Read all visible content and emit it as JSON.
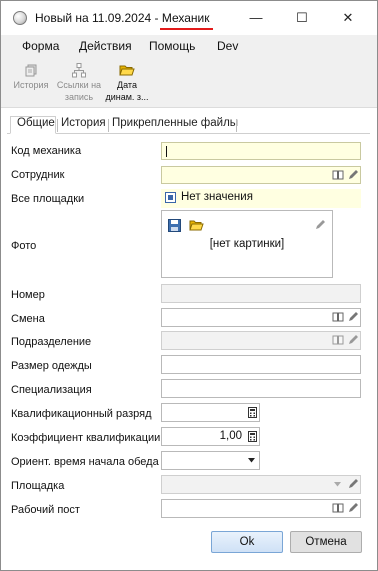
{
  "window": {
    "title_prefix": "Новый на 11.09.2024 - ",
    "title_entity": "Механик",
    "controls": {
      "minimize": "—",
      "maximize": "☐",
      "close": "✕"
    }
  },
  "menu": [
    "Форма",
    "Действия",
    "Помощь",
    "Dev"
  ],
  "toolbar": {
    "history_label": "История",
    "links_label_1": "Ссылки на",
    "links_label_2": "запись",
    "date_label_1": "Дата",
    "date_label_2": "динам. з..."
  },
  "tabs": [
    "Общие",
    "История",
    "Прикрепленные файлы"
  ],
  "fields": {
    "mechanic_code": "Код механика",
    "employee": "Сотрудник",
    "all_sites": "Все площадки",
    "all_sites_value": "Нет значения",
    "photo": "Фото",
    "photo_empty": "[нет картинки]",
    "number": "Номер",
    "shift": "Смена",
    "department": "Подразделение",
    "clothing_size": "Размер одежды",
    "specialization": "Специализация",
    "qualification_grade": "Квалификационный разряд",
    "qualification_coef": "Коэффициент квалификации",
    "qualification_coef_value": "1,00",
    "lunch_start": "Ориент. время начала обеда",
    "site": "Площадка",
    "work_post": "Рабочий пост"
  },
  "buttons": {
    "ok": "Ok",
    "cancel": "Отмена"
  },
  "colors": {
    "required_bg": "#ffffe1",
    "accent_underline": "#e31b1b",
    "ok_border": "#7aa6d6"
  }
}
